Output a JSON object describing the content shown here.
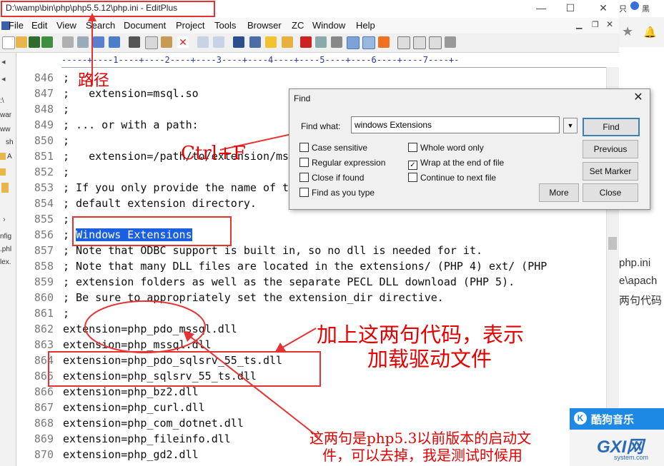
{
  "window": {
    "title": "D:\\wamp\\bin\\php\\php5.5.12\\php.ini - EditPlus",
    "controls": [
      "—",
      "☐",
      "✕"
    ]
  },
  "menu": [
    "File",
    "Edit",
    "View",
    "Search",
    "Document",
    "Project",
    "Tools",
    "Browser",
    "ZC",
    "Window",
    "Help"
  ],
  "ruler": "-----+----1----+----2----+----3----+----4----+----5----+----6----+----7----+-",
  "left_panel": [
    ":\\",
    "war",
    "ww",
    "sh",
    "A",
    "nfig",
    ".phl",
    "lex."
  ],
  "editor": {
    "lines": [
      {
        "n": "846",
        "text": ";"
      },
      {
        "n": "847",
        "text": ";   extension=msql.so"
      },
      {
        "n": "848",
        "text": ";"
      },
      {
        "n": "849",
        "text": "; ... or with a path:"
      },
      {
        "n": "850",
        "text": ";"
      },
      {
        "n": "851",
        "text": ";   extension=/path/to/extension/msql.so"
      },
      {
        "n": "852",
        "text": ";"
      },
      {
        "n": "853",
        "text": "; If you only provide the name of the extension, PHP will look for it in its"
      },
      {
        "n": "854",
        "text": "; default extension directory."
      },
      {
        "n": "855",
        "text": ";"
      },
      {
        "n": "856",
        "text": "; "
      },
      {
        "n": "857",
        "text": "; Note that ODBC support is built in, so no dll is needed for it."
      },
      {
        "n": "858",
        "text": "; Note that many DLL files are located in the extensions/ (PHP 4) ext/ (PHP"
      },
      {
        "n": "859",
        "text": "; extension folders as well as the separate PECL DLL download (PHP 5)."
      },
      {
        "n": "860",
        "text": "; Be sure to appropriately set the extension_dir directive."
      },
      {
        "n": "861",
        "text": ";"
      },
      {
        "n": "862",
        "text": "extension=php_pdo_mssql.dll"
      },
      {
        "n": "863",
        "text": "extension=php_mssql.dll"
      },
      {
        "n": "864",
        "text": "extension=php_pdo_sqlsrv_55_ts.dll"
      },
      {
        "n": "865",
        "text": "extension=php_sqlsrv_55_ts.dll"
      },
      {
        "n": "866",
        "text": "extension=php_bz2.dll"
      },
      {
        "n": "867",
        "text": "extension=php_curl.dll"
      },
      {
        "n": "868",
        "text": "extension=php_com_dotnet.dll"
      },
      {
        "n": "869",
        "text": "extension=php_fileinfo.dll"
      },
      {
        "n": "870",
        "text": "extension=php_gd2.dll"
      }
    ],
    "selected_text": "Windows Extensions"
  },
  "find_dialog": {
    "title": "Find",
    "label": "Find what:",
    "value": "windows Extensions",
    "buttons": {
      "find": "Find",
      "previous": "Previous",
      "set_marker": "Set Marker",
      "more": "More",
      "close": "Close"
    },
    "checkboxes": [
      {
        "label": "Case sensitive",
        "checked": false
      },
      {
        "label": "Regular expression",
        "checked": false
      },
      {
        "label": "Close if found",
        "checked": false
      },
      {
        "label": "Find as you type",
        "checked": false
      },
      {
        "label": "Whole word only",
        "checked": false
      },
      {
        "label": "Wrap at the end of file",
        "checked": true
      },
      {
        "label": "Continue to next file",
        "checked": false
      }
    ]
  },
  "annotations": {
    "path": "路径",
    "shortcut": "Ctrl+F",
    "add_lines": "加上这两句代码，表示",
    "add_lines_2": "加载驱动文件",
    "old_note": "这两句是php5.3以前版本的启动文",
    "old_note_2": "件，可以去掉，我是测试时候用"
  },
  "side_app": {
    "top_left": "只",
    "top_right": "黑",
    "snippets": [
      "php.ini",
      "e\\apach",
      "两句代码"
    ],
    "kugou": "酷狗音乐",
    "watermark": "GXI网",
    "watermark_url": "system.com"
  },
  "colors": {
    "selection": "#1a5fe0",
    "annotation": "#e60000",
    "kugou": "#1e88e5"
  }
}
